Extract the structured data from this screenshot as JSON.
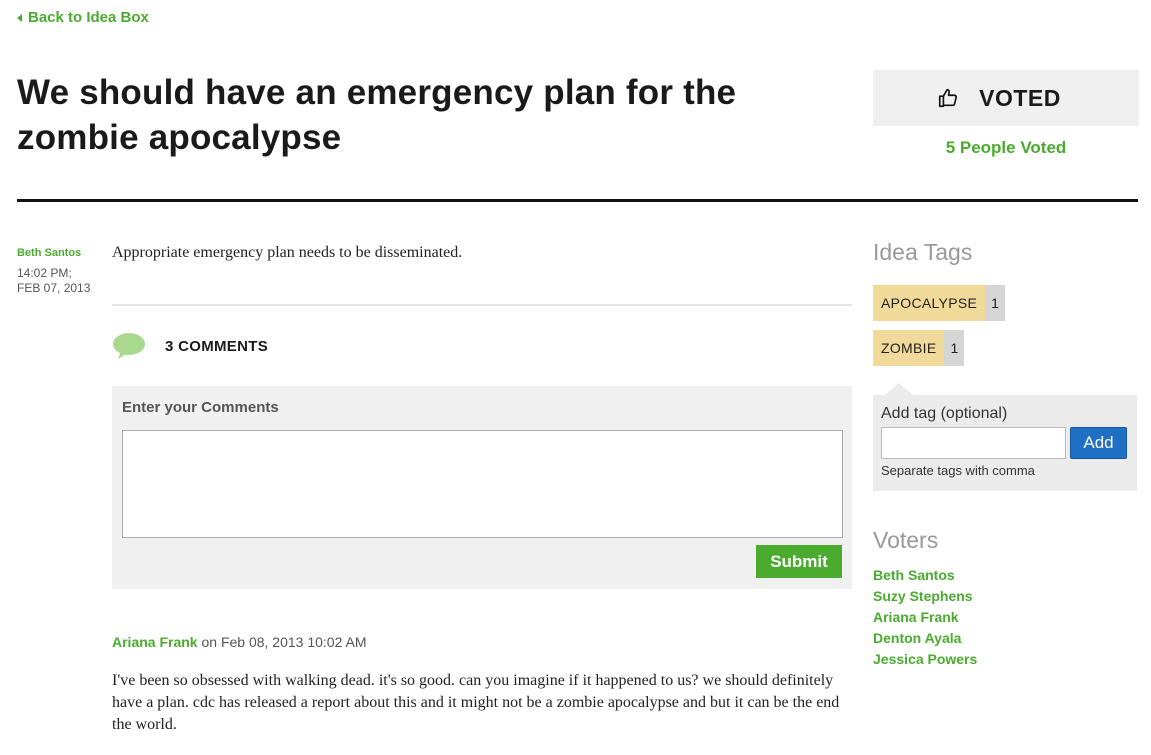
{
  "nav": {
    "back_label": "Back to Idea Box"
  },
  "idea": {
    "title": "We should have an emergency plan for the zombie apocalypse",
    "author": "Beth Santos",
    "time_line1": "14:02 PM;",
    "time_line2": "FEB 07, 2013",
    "description": "Appropriate emergency plan needs to be disseminated."
  },
  "vote": {
    "label": "VOTED",
    "count_text": "5 People Voted",
    "icon": "thumbs-up-icon"
  },
  "comments": {
    "count_label": "3 COMMENTS",
    "icon": "speech-bubble-icon",
    "form_label": "Enter your Comments",
    "textarea_value": "",
    "submit_label": "Submit",
    "items": [
      {
        "author": "Ariana Frank",
        "date_text": "on Feb 08, 2013 10:02 AM",
        "text": "I've been so obsessed with walking dead. it's so good. can you imagine if it happened to us? we should definitely have a plan. cdc has released a report about this and it might not be a zombie apocalypse and but it can be the end the world."
      }
    ]
  },
  "sidebar": {
    "tags_heading": "Idea Tags",
    "tags": [
      {
        "name": "APOCALYPSE",
        "count": "1"
      },
      {
        "name": "ZOMBIE",
        "count": "1"
      }
    ],
    "add_tag": {
      "label": "Add tag (optional)",
      "value": "",
      "button_label": "Add",
      "hint": "Separate tags with comma"
    },
    "voters_heading": "Voters",
    "voters": [
      "Beth Santos",
      "Suzy Stephens",
      "Ariana Frank",
      "Denton Ayala",
      "Jessica Powers"
    ]
  },
  "colors": {
    "accent_green": "#4aab2f",
    "tag_bg": "#f1d99a",
    "add_button_blue": "#1f6fc5",
    "panel_gray": "#efefef"
  }
}
